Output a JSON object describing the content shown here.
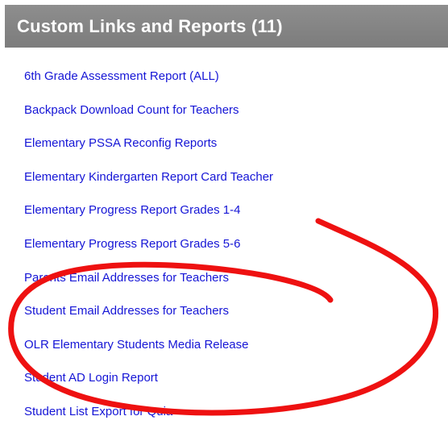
{
  "panel": {
    "title": "Custom Links and Reports (11)"
  },
  "links": [
    {
      "label": "6th Grade Assessment Report (ALL)"
    },
    {
      "label": "Backpack Download Count for Teachers"
    },
    {
      "label": "Elementary PSSA Reconfig Reports"
    },
    {
      "label": "Elementary Kindergarten Report Card Teacher"
    },
    {
      "label": "Elementary Progress Report Grades 1-4"
    },
    {
      "label": "Elementary Progress Report Grades 5-6"
    },
    {
      "label": "Parents Email Addresses for Teachers"
    },
    {
      "label": "Student Email Addresses for Teachers"
    },
    {
      "label": "OLR Elementary Students Media Release"
    },
    {
      "label": "Student AD Login Report"
    },
    {
      "label": "Student List Export for Quia"
    }
  ],
  "colors": {
    "header_bg": "#858585",
    "header_text": "#ffffff",
    "link": "#1515d6",
    "annotation": "#ee1111"
  }
}
